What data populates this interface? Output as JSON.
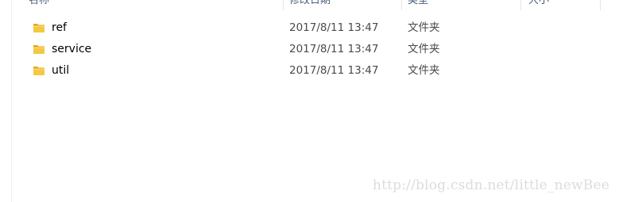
{
  "columns": {
    "name": "名称",
    "date_modified": "修改日期",
    "type": "类型",
    "size": "大小"
  },
  "files": [
    {
      "name": "ref",
      "date": "2017/8/11 13:47",
      "type": "文件夹",
      "icon": "folder-icon"
    },
    {
      "name": "service",
      "date": "2017/8/11 13:47",
      "type": "文件夹",
      "icon": "folder-icon"
    },
    {
      "name": "util",
      "date": "2017/8/11 13:47",
      "type": "文件夹",
      "icon": "folder-icon"
    }
  ],
  "colors": {
    "folder_body": "#f0c040",
    "folder_tab": "#e6a817",
    "header_text": "#4c607a"
  },
  "watermark": "http://blog.csdn.net/little_newBee"
}
